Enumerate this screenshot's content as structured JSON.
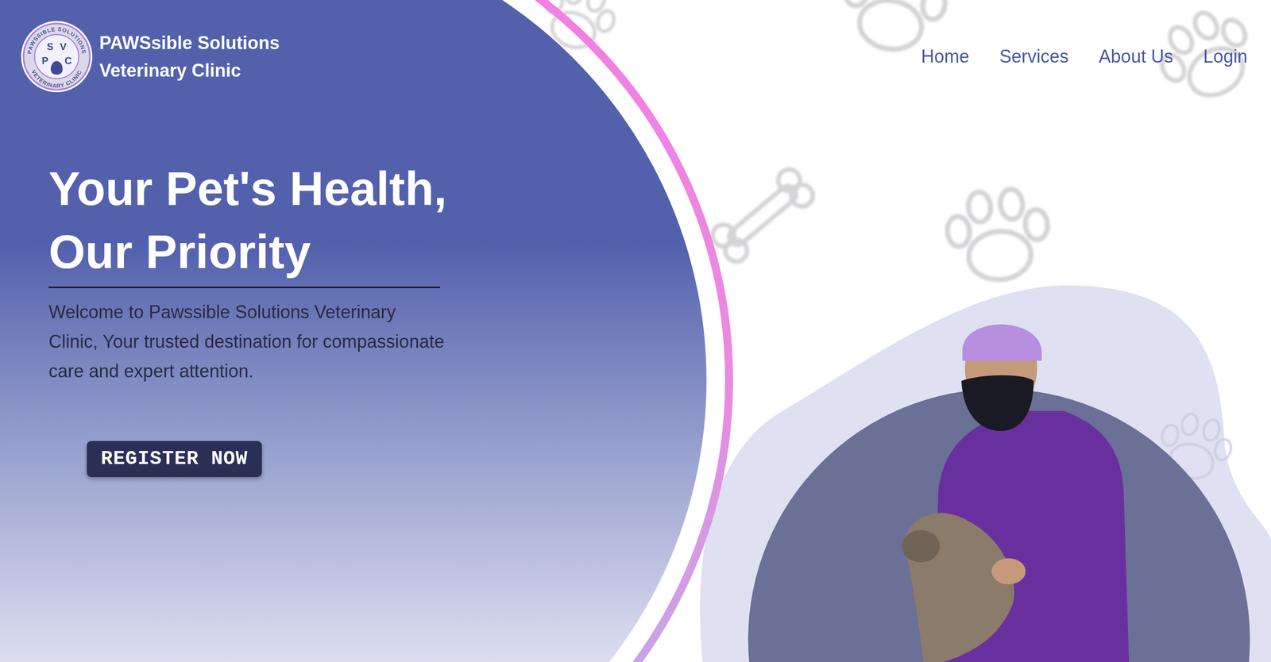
{
  "brand": {
    "logo": {
      "top_text": "PAWSSIBLE SOLUTIONS",
      "bottom_text": "VETERINARY CLINIC",
      "letters": [
        "P",
        "S",
        "V",
        "C"
      ]
    },
    "name_line1": "PAWSsible Solutions",
    "name_line2": "Veterinary Clinic"
  },
  "nav": [
    {
      "label": "Home"
    },
    {
      "label": "Services"
    },
    {
      "label": "About Us"
    },
    {
      "label": "Login"
    }
  ],
  "hero": {
    "title_line1": "Your Pet's Health,",
    "title_line2": "Our Priority",
    "text": "Welcome to Pawssible Solutions Veterinary Clinic, Your trusted destination for compassionate care and expert attention.",
    "button": "REGISTER NOW"
  }
}
